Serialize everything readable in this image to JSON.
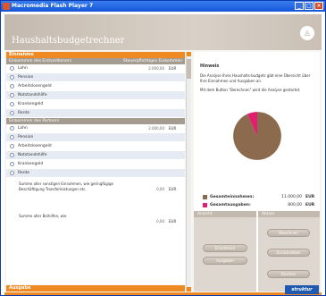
{
  "window": {
    "title": "Macromedia Flash Player 7",
    "btn_min": "_",
    "btn_max": "□",
    "btn_close": "×"
  },
  "app": {
    "title": "Haushaltsbudgetrechner",
    "logo": "◬"
  },
  "left": {
    "einnahme_header": "Einnahme",
    "sub1": {
      "left": "Einkommen des Erstverdieners",
      "right": "Steuerpflichtiges Einkommen"
    },
    "rows1": [
      {
        "label": "Lohn",
        "value": "2.000,00",
        "cur": "EUR"
      },
      {
        "label": "Pension",
        "value": "",
        "cur": ""
      },
      {
        "label": "Arbeitslosengeld",
        "value": "",
        "cur": ""
      },
      {
        "label": "Notstandshilfe",
        "value": "",
        "cur": ""
      },
      {
        "label": "Krankengeld",
        "value": "",
        "cur": ""
      },
      {
        "label": "Rente",
        "value": "",
        "cur": ""
      }
    ],
    "sub2": {
      "left": "Einkommen des Partners",
      "right": ""
    },
    "rows2": [
      {
        "label": "Lohn",
        "value": "2.000,00",
        "cur": "EUR"
      },
      {
        "label": "Pension",
        "value": "",
        "cur": ""
      },
      {
        "label": "Arbeitslosengeld",
        "value": "",
        "cur": ""
      },
      {
        "label": "Notstandshilfe",
        "value": "",
        "cur": ""
      },
      {
        "label": "Krankengeld",
        "value": "",
        "cur": ""
      },
      {
        "label": "Rente",
        "value": "",
        "cur": ""
      }
    ],
    "other1": {
      "label": "Summe aller sonstigen Einnahmen, wie geringfügige Beschäftigung Transferleistungen etc.",
      "value": "0,00",
      "cur": "EUR"
    },
    "other2": {
      "label": "Summe aller Beihilfen, wie",
      "value": "0,00",
      "cur": "EUR"
    },
    "ausgabe_header": "Ausgabe"
  },
  "right": {
    "hinweis_title": "Hinweis",
    "hinweis_text1": "Die Analyse Ihres Haushalts-budgets gibt eine Übersicht über Ihre Einnahmen und Ausgaben an.",
    "hinweis_text2": "Mit dem Button \"Berechnen\" wird die Analyse gestartet.",
    "legend": [
      {
        "name": "Gesamteinnahmen:",
        "value": "11.000,00",
        "cur": "EUR",
        "color": "#8b6a4e"
      },
      {
        "name": "Gesamtausgaben:",
        "value": "800,00",
        "cur": "EUR",
        "color": "#e0206e"
      }
    ],
    "panels": {
      "ansicht": "Ansicht",
      "aktion": "Aktion",
      "btn_einnahmen": "Einnahmen",
      "btn_ausgaben": "Ausgaben",
      "btn_berechnen": "Berechnen",
      "btn_zuruecksetzen": "Zurücksetzen",
      "btn_drucken": "Drucken"
    }
  },
  "chart_data": {
    "type": "pie",
    "labels": [
      "Gesamteinnahmen",
      "Gesamtausgaben"
    ],
    "values": [
      11000,
      800
    ],
    "colors": [
      "#8b6a4e",
      "#e0206e"
    ]
  },
  "brand": "struktur",
  "colors": {
    "accent": "#ef8a22",
    "header": "#c4b9ae",
    "row_alt": "#e6ebf3",
    "brand": "#1f5ab0"
  }
}
